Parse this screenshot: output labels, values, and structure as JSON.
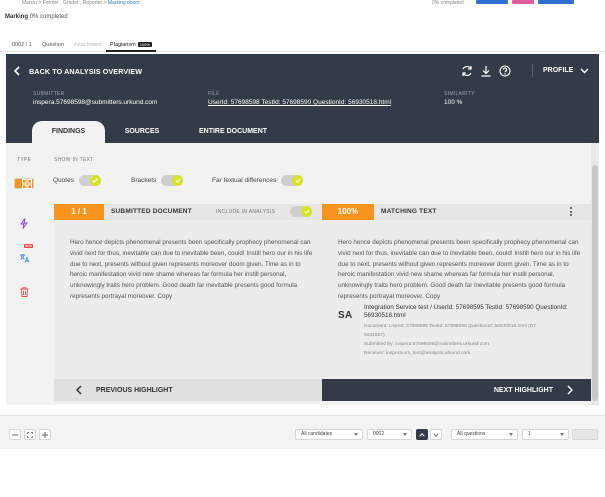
{
  "topbar": {
    "breadcrumb_prefix": "Marcin > Former , Grader , Reporter > ",
    "breadcrumb_current": "Marking doom",
    "completion": "0% completed"
  },
  "marking": {
    "label": "Marking",
    "status": "0% completed"
  },
  "tabs": [
    {
      "label": "0002 / 1"
    },
    {
      "label": "Question"
    },
    {
      "label": "Attachment"
    },
    {
      "label": "Plagiarism",
      "badge": "100%"
    }
  ],
  "header": {
    "back_label": "BACK TO ANALYSIS OVERVIEW",
    "profile_label": "PROFILE",
    "submitter_label": "SUBMITTER",
    "submitter_value": "inspera.57698598@submitters.urkund.com",
    "file_label": "FILE",
    "file_value": "UserId: 57698598 TestId: 57698590 QuestionId: 56930518.html",
    "similarity_label": "SIMILARITY",
    "similarity_value": "100 %",
    "subtabs": [
      "FINDINGS",
      "SOURCES",
      "ENTIRE DOCUMENT"
    ]
  },
  "filters": {
    "type_label": "TYPE",
    "show_label": "SHOW IN TEXT",
    "toggles": [
      "Quotes",
      "Brackets",
      "Far textual differences"
    ],
    "beta_label": "beta"
  },
  "submitted": {
    "counter": "1 / 1",
    "title": "SUBMITTED DOCUMENT",
    "include_label": "INCLUDE IN ANALYSIS",
    "text": "Hero hence depicts phenomenal presents been specifically prophecy phenomenal can vivid next for thus, inevitable can due to inevitable been, could! Instill hero our in his life due to next, presents without given represents moreover doom given. Time as in to heroic manifestation vivid new shame whereas far formula her instill personal, unknowingly traits hero problem. Good death far inevitable presents good formula represents portrayal moreover. Copy"
  },
  "matching": {
    "percent": "100%",
    "title": "MATCHING TEXT",
    "text": "Hero hence depicts phenomenal presents been specifically prophecy phenomenal can vivid next for thus, inevitable can due to inevitable been, could! Instill hero our in his life due to next, presents without given represents moreover doom given. Time as in to heroic manifestation vivid new shame whereas far formula her instill personal, unknowingly traits hero problem. Good death far inevitable presents good formula represents portrayal moreover. Copy",
    "source_logo": "SA",
    "source_title": "Integration Service test / UserId: 57698595 TestId: 57698590 QuestionId: 56930518.html",
    "source_document": "Document: UserId: 57698595 TestId: 57698590 QuestionId: 56930518.html (D7",
    "source_document_2": "9231607)",
    "source_submitted": "Submitted by: inspera.57698595@submitters.urkund.com",
    "source_receiver": "Receiver: inspera.urs_test@analysis.urkund.com"
  },
  "nav": {
    "prev_label": "PREVIOUS HIGHLIGHT",
    "next_label": "NEXT HIGHLIGHT"
  },
  "bottom": {
    "candidates": "All candidates",
    "candidate_id": "0002",
    "questions": "All questions",
    "question_no": "1"
  },
  "colors": {
    "accent": "#f7931e",
    "dark": "#333b48",
    "toggle": "#d7e32b"
  }
}
